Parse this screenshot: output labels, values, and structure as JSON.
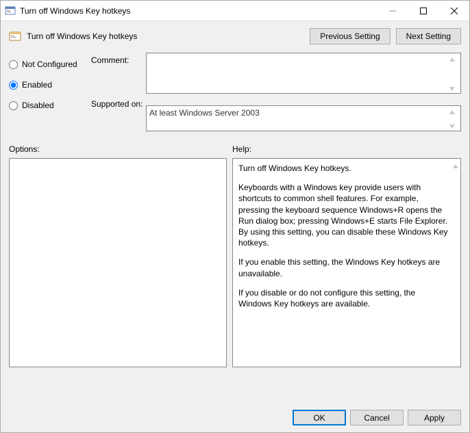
{
  "window": {
    "title": "Turn off Windows Key hotkeys"
  },
  "header": {
    "title": "Turn off Windows Key hotkeys",
    "prev_btn": "Previous Setting",
    "next_btn": "Next Setting"
  },
  "state": {
    "options": {
      "not_configured": "Not Configured",
      "enabled": "Enabled",
      "disabled": "Disabled"
    },
    "selected": "enabled"
  },
  "labels": {
    "comment": "Comment:",
    "supported": "Supported on:",
    "options": "Options:",
    "help": "Help:"
  },
  "comment_value": "",
  "supported_value": "At least Windows Server 2003",
  "help": {
    "p1": "Turn off Windows Key hotkeys.",
    "p2": "Keyboards with a Windows key provide users with shortcuts to common shell features. For example, pressing the keyboard sequence Windows+R opens the Run dialog box; pressing Windows+E starts File Explorer. By using this setting, you can disable these Windows Key hotkeys.",
    "p3": "If you enable this setting, the Windows Key hotkeys are unavailable.",
    "p4": "If you disable or do not configure this setting, the Windows Key hotkeys are available."
  },
  "footer": {
    "ok": "OK",
    "cancel": "Cancel",
    "apply": "Apply"
  }
}
